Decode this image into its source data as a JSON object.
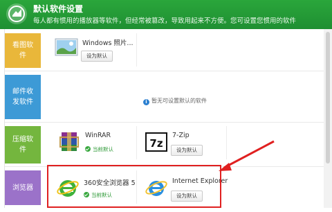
{
  "header": {
    "title": "默认软件设置",
    "subtitle": "每人都有惯用的播放器等软件，但经常被篡改，导致用起来不方便。您可设置您惯用的软件"
  },
  "categories": [
    {
      "label": "看图软件",
      "color": "#e9b73a"
    },
    {
      "label": "邮件收发软件",
      "color": "#3d9ad6"
    },
    {
      "label": "压缩软件",
      "color": "#74b63e"
    },
    {
      "label": "浏览器",
      "color": "#9b72c9"
    }
  ],
  "image_viewer": {
    "name": "Windows 照片...",
    "button": "设为默认"
  },
  "mail": {
    "info": "暂无可设置默认的软件"
  },
  "compress": {
    "app1": {
      "name": "WinRAR",
      "status": "当前默认"
    },
    "app2": {
      "name": "7-Zip",
      "button": "设为默认"
    }
  },
  "browser": {
    "app1": {
      "name": "360安全浏览器 5",
      "status": "当前默认"
    },
    "app2": {
      "name": "Internet Explorer",
      "button": "设为默认"
    }
  },
  "colors": {
    "header": "#239b36",
    "accent_green": "#2f9a38",
    "highlight": "#e02020"
  }
}
